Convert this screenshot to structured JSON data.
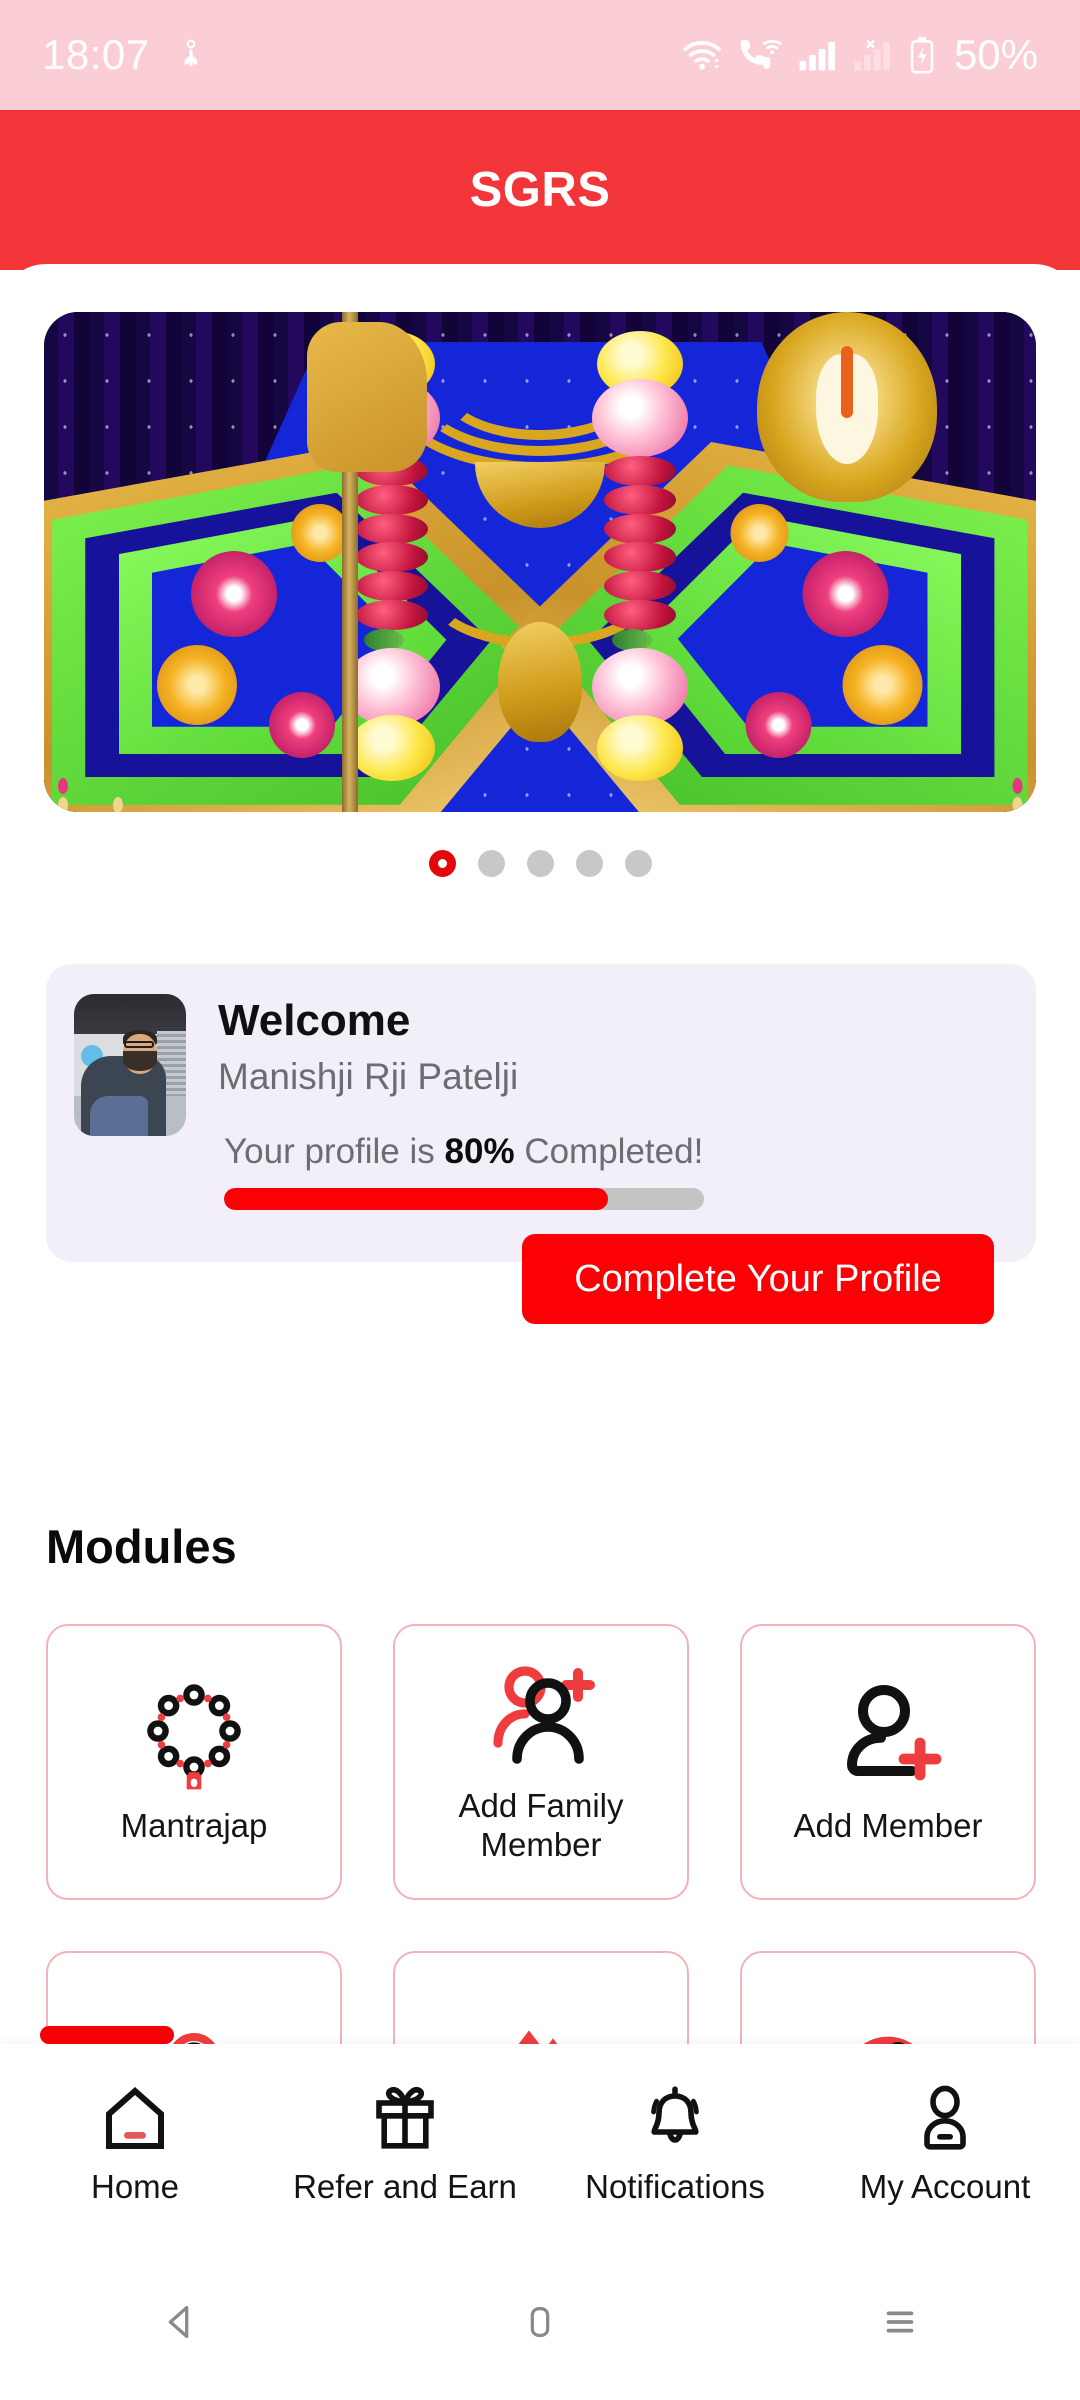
{
  "status_bar": {
    "time": "18:07",
    "battery_percent": "50%",
    "icons": [
      "sprout-icon",
      "wifi-icon",
      "vowifi-call-icon",
      "signal-bars-icon",
      "no-signal-x-icon",
      "battery-charging-icon"
    ]
  },
  "header": {
    "title": "SGRS",
    "bg_color": "#f23538"
  },
  "carousel": {
    "slide_alt": "Hindu deity idol adorned with gold jewelry and flower garlands",
    "total_dots": 5,
    "active_index": 0
  },
  "welcome": {
    "greeting": "Welcome",
    "user_name": "Manishji Rji Patelji",
    "progress_prefix": "Your profile is",
    "progress_value": "80%",
    "progress_suffix": "Completed!",
    "progress_percent": 80,
    "cta_label": "Complete Your Profile",
    "card_bg": "#f3eff8",
    "accent_color": "#fb0005"
  },
  "modules": {
    "heading": "Modules",
    "items": [
      {
        "label": "Mantrajap",
        "icon": "prayer-beads-mala-icon"
      },
      {
        "label": "Add Family Member",
        "icon": "add-family-member-icon"
      },
      {
        "label": "Add Member",
        "icon": "add-member-icon"
      },
      {
        "label": "",
        "icon": "donation-coin-icon"
      },
      {
        "label": "",
        "icon": "blood-donation-drop-icon"
      },
      {
        "label": "",
        "icon": "no-hand-prohibited-icon"
      }
    ]
  },
  "bottom_nav": {
    "items": [
      {
        "label": "Home",
        "icon": "home-icon",
        "active": true
      },
      {
        "label": "Refer and Earn",
        "icon": "gift-icon",
        "active": false
      },
      {
        "label": "Notifications",
        "icon": "bell-icon",
        "active": false
      },
      {
        "label": "My Account",
        "icon": "person-icon",
        "active": false
      }
    ]
  },
  "system_nav": {
    "back": "back-triangle-icon",
    "home": "home-square-icon",
    "recents": "recents-lines-icon"
  }
}
